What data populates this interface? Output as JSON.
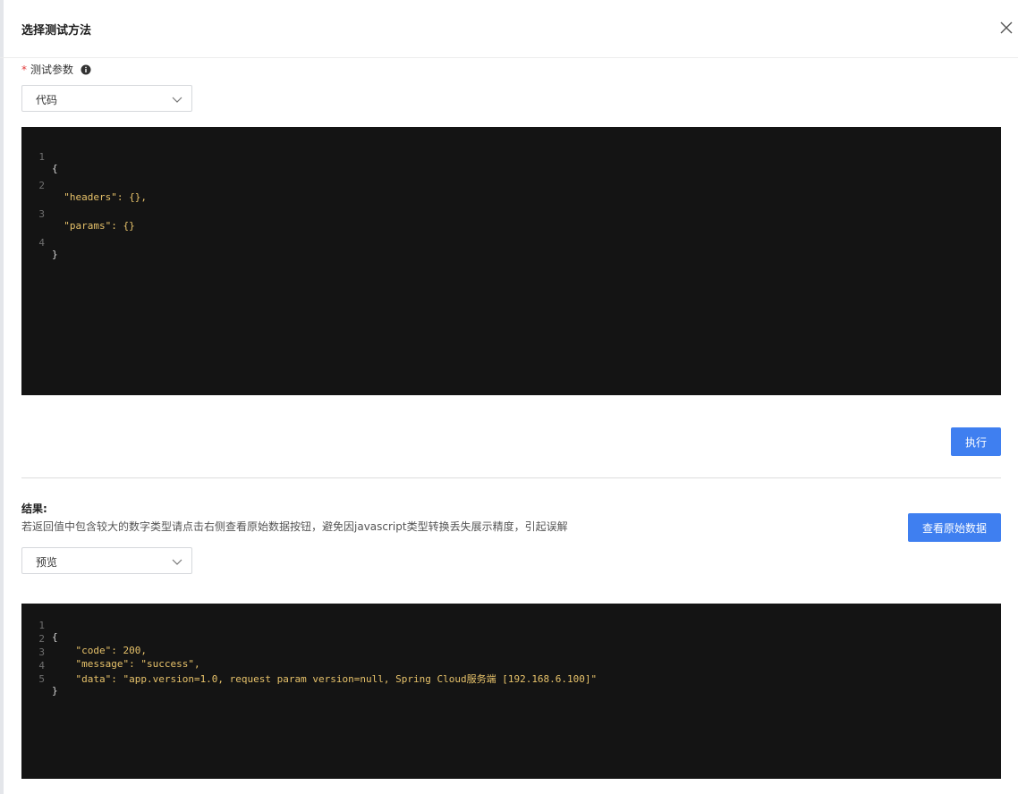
{
  "dialog": {
    "title": "选择测试方法",
    "close_icon": "close-icon"
  },
  "params": {
    "required_mark": "*",
    "label": "测试参数",
    "info_icon": "info-icon",
    "select_value": "代码",
    "code_lines": [
      {
        "num": "1",
        "text": "{"
      },
      {
        "num": "2",
        "text": "  \"headers\": {},"
      },
      {
        "num": "3",
        "text": "  \"params\": {}"
      },
      {
        "num": "4",
        "text": "}"
      }
    ]
  },
  "execute_label": "执行",
  "result": {
    "title": "结果:",
    "hint": "若返回值中包含较大的数字类型请点击右侧查看原始数据按钮，避免因javascript类型转换丢失展示精度，引起误解",
    "raw_button_label": "查看原始数据",
    "select_value": "预览",
    "code_lines": [
      {
        "num": "1",
        "text": "{"
      },
      {
        "num": "2",
        "text": "    \"code\": 200,"
      },
      {
        "num": "3",
        "text": "    \"message\": \"success\","
      },
      {
        "num": "4",
        "text": "    \"data\": \"app.version=1.0, request param version=null, Spring Cloud服务端 [192.168.6.100]\""
      },
      {
        "num": "5",
        "text": "}"
      }
    ]
  },
  "colors": {
    "primary": "#3f7ff0",
    "editor_bg": "#141414",
    "required": "#e23b3b",
    "code_key": "#e7c26a",
    "code_number": "#b58ad8"
  }
}
